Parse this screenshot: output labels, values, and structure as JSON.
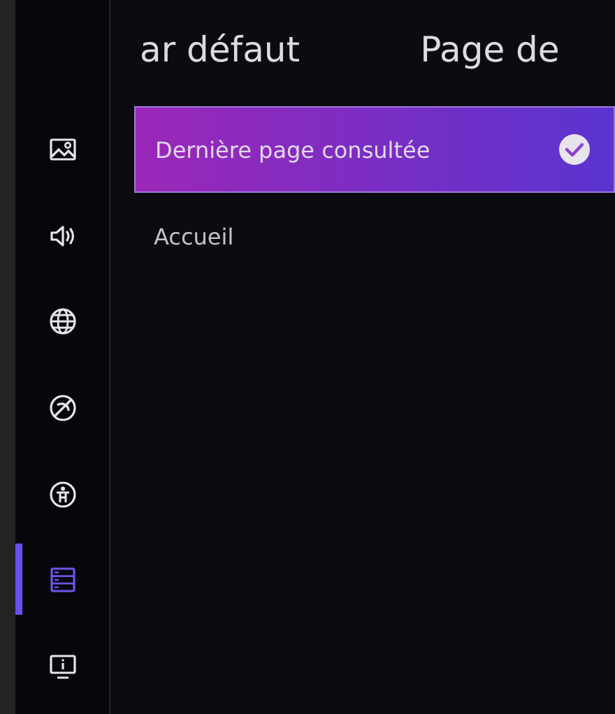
{
  "sidebar": {
    "items": [
      {
        "selected": false
      },
      {
        "selected": false
      },
      {
        "selected": false
      },
      {
        "selected": false
      },
      {
        "selected": false
      },
      {
        "selected": true
      },
      {
        "selected": false
      }
    ]
  },
  "headers": [
    "ar défaut",
    "Page de"
  ],
  "options": [
    {
      "label": "Dernière page consultée",
      "selected": true
    },
    {
      "label": "Accueil",
      "selected": false
    }
  ]
}
